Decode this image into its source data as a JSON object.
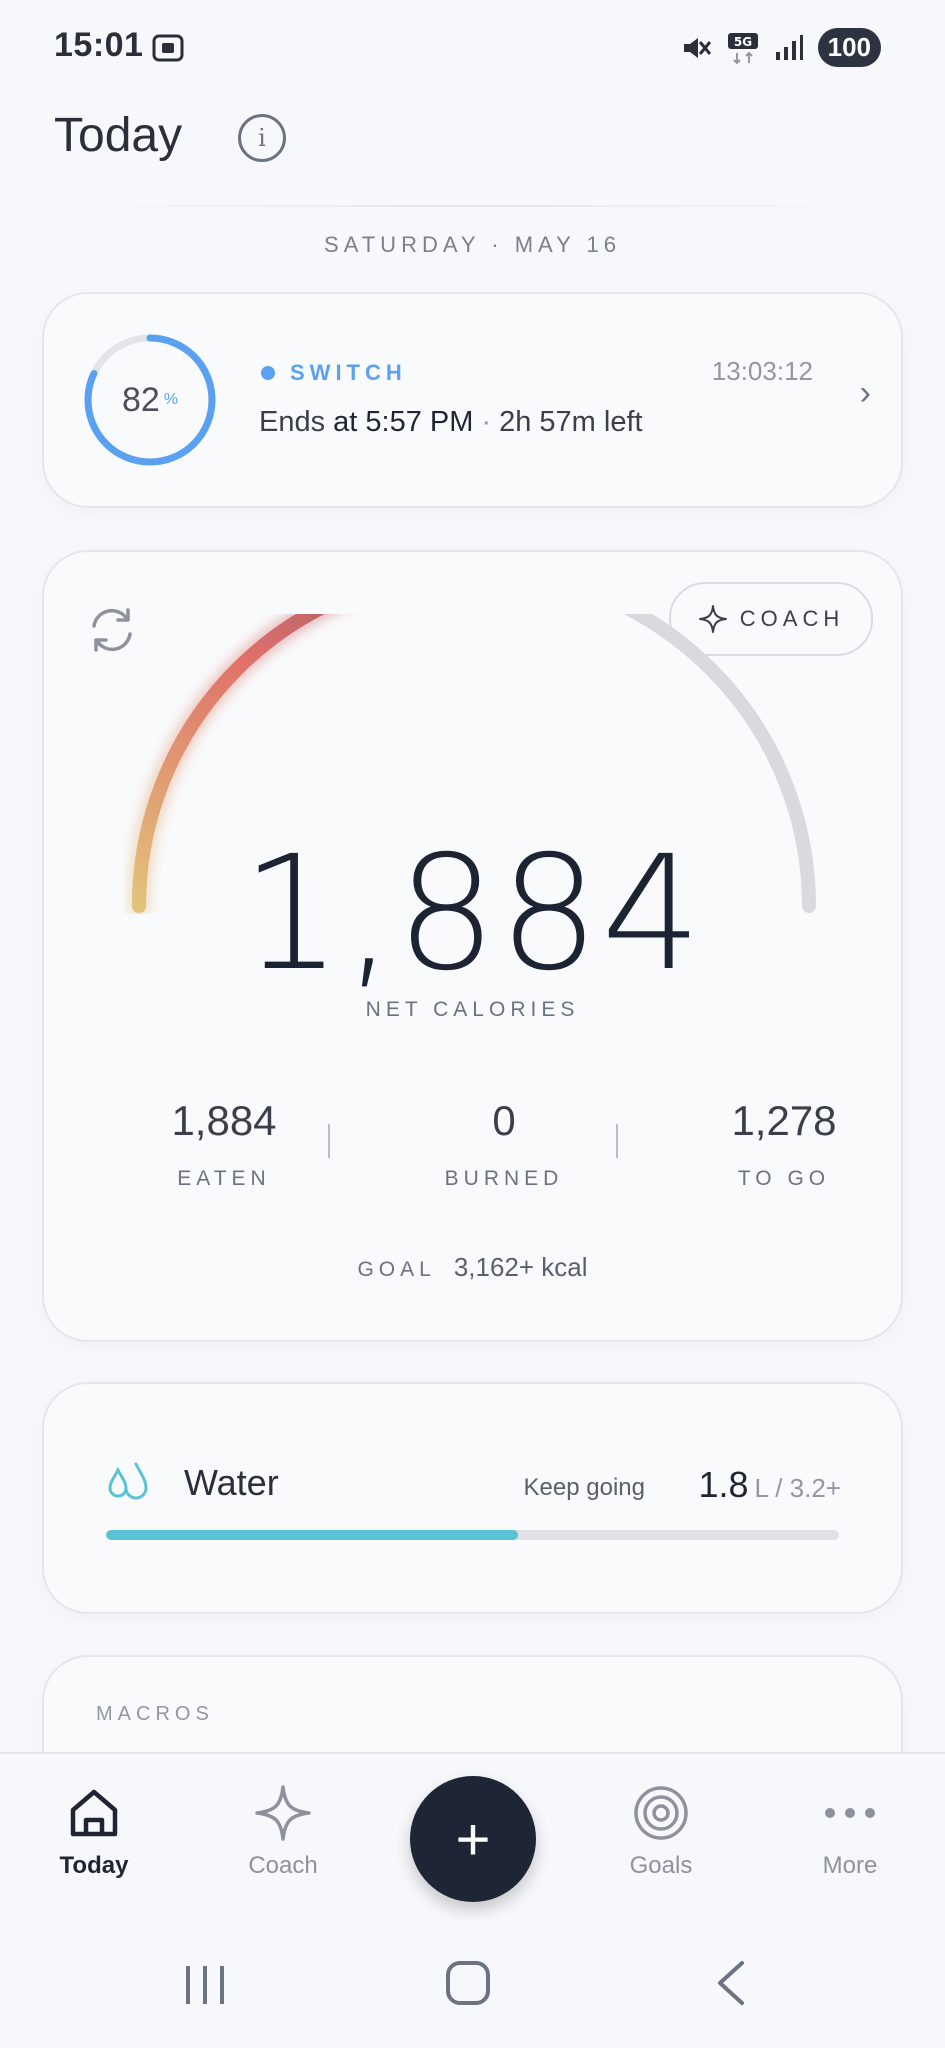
{
  "status_bar": {
    "time": "15:01",
    "battery": "100"
  },
  "header": {
    "title": "Today"
  },
  "date": "SATURDAY · MAY 16",
  "fast": {
    "percent": "82",
    "percent_symbol": "%",
    "progress": 0.82,
    "label": "SWITCH",
    "elapsed": "13:03:12",
    "ends_prefix": "Ends",
    "ends_at_word": "at",
    "ends_time": "5:57 PM",
    "separator": "·",
    "time_left": "2h 57m left"
  },
  "calories": {
    "coach_label": "COACH",
    "net_value": "1,884",
    "net_label": "NET CALORIES",
    "gauge_progress": 0.6,
    "stats": [
      {
        "value": "1,884",
        "label": "EATEN"
      },
      {
        "value": "0",
        "label": "BURNED"
      },
      {
        "value": "1,278",
        "label": "TO GO"
      }
    ],
    "goal_label": "GOAL",
    "goal_value": "3,162+ kcal"
  },
  "water": {
    "title": "Water",
    "status": "Keep going",
    "value": "1.8",
    "unit_goal": "L / 3.2+",
    "progress": 0.5625
  },
  "macros": {
    "label": "MACROS"
  },
  "nav": {
    "items": [
      {
        "label": "Today",
        "icon": "home-icon"
      },
      {
        "label": "Coach",
        "icon": "sparkle-icon"
      },
      {
        "label": "Goals",
        "icon": "target-icon"
      },
      {
        "label": "More",
        "icon": "more-icon"
      }
    ],
    "fab_label": "+"
  },
  "colors": {
    "accent_blue": "#5aa1f2",
    "water": "#59c3d4",
    "fab": "#1e2535",
    "gauge_start": "#e2c27a",
    "gauge_mid": "#e0706a",
    "gauge_end": "#5a4566"
  }
}
